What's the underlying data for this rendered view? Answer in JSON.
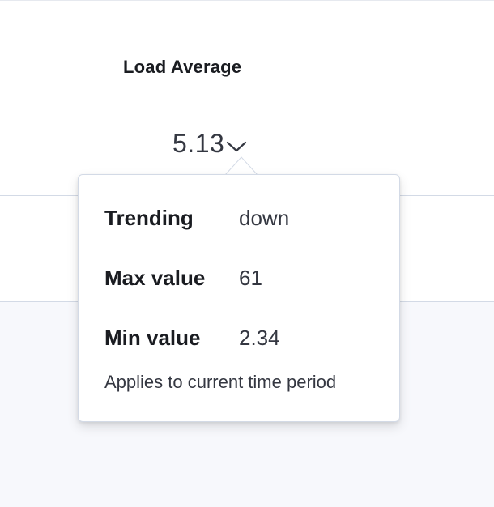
{
  "table": {
    "column_header": "Load Average",
    "cell": {
      "value": "5.13",
      "trend_icon": "chevron-down-icon"
    }
  },
  "popover": {
    "rows": [
      {
        "label": "Trending",
        "value": "down"
      },
      {
        "label": "Max value",
        "value": "61"
      },
      {
        "label": "Min value",
        "value": "2.34"
      }
    ],
    "note": "Applies to current time period"
  },
  "colors": {
    "page_background": "#f7f8fc",
    "panel_background": "#ffffff",
    "border": "#d3dae6",
    "text_primary": "#1a1c21",
    "text_secondary": "#343741"
  }
}
